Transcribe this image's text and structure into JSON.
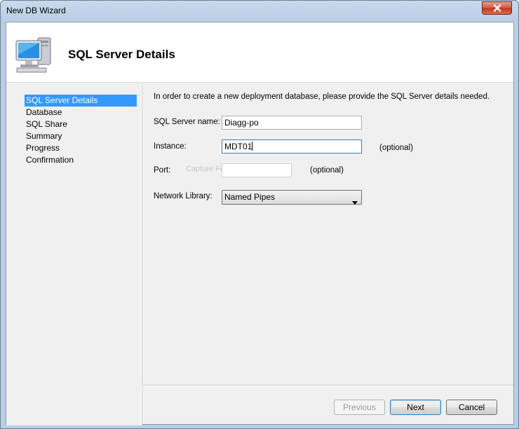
{
  "window": {
    "title": "New DB Wizard"
  },
  "header": {
    "title": "SQL Server Details",
    "icon": "computer-monitor-icon"
  },
  "nav": {
    "items": [
      {
        "label": "SQL Server Details",
        "active": true
      },
      {
        "label": "Database",
        "active": false
      },
      {
        "label": "SQL Share",
        "active": false
      },
      {
        "label": "Summary",
        "active": false
      },
      {
        "label": "Progress",
        "active": false
      },
      {
        "label": "Confirmation",
        "active": false
      }
    ],
    "active_color": "#3399ff"
  },
  "form": {
    "intro": "In order to create a new deployment database, please provide the SQL Server details needed.",
    "server_name": {
      "label": "SQL Server name:",
      "value": "Diagg-po"
    },
    "instance": {
      "label": "Instance:",
      "value": "MDT01",
      "hint": "(optional)"
    },
    "port": {
      "label": "Port:",
      "value": "",
      "hint": "(optional)",
      "ghost_text": "Capture Fenêtre"
    },
    "network_library": {
      "label": "Network Library:",
      "value": "Named Pipes"
    }
  },
  "buttons": {
    "previous": "Previous",
    "next": "Next",
    "cancel": "Cancel"
  }
}
